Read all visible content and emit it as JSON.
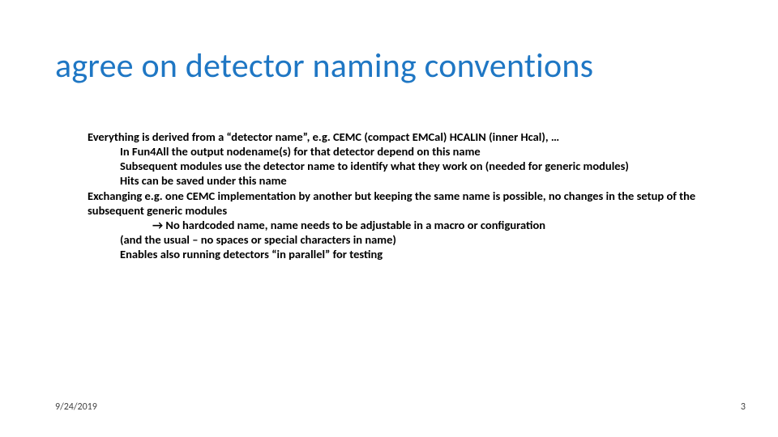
{
  "title": "agree on detector naming conventions",
  "body": {
    "p0": "Everything is derived from a “detector name”, e.g. CEMC (compact EMCal) HCALIN (inner Hcal), …",
    "p0a": "In Fun4All the output nodename(s) for that detector depend on this name",
    "p0b": "Subsequent modules use the detector name to identify what they work on (needed for generic modules)",
    "p0c": "Hits can be saved under this name",
    "p1": "Exchanging e.g. one CEMC implementation by another but keeping the same name is possible, no changes in the setup of the subsequent generic modules",
    "p1a": "→ No hardcoded name, name needs to be adjustable in a macro or configuration",
    "p1b": "(and the usual – no spaces or special characters in name)",
    "p1c": "Enables also running detectors “in parallel” for testing"
  },
  "footer": {
    "date": "9/24/2019",
    "page": "3"
  }
}
